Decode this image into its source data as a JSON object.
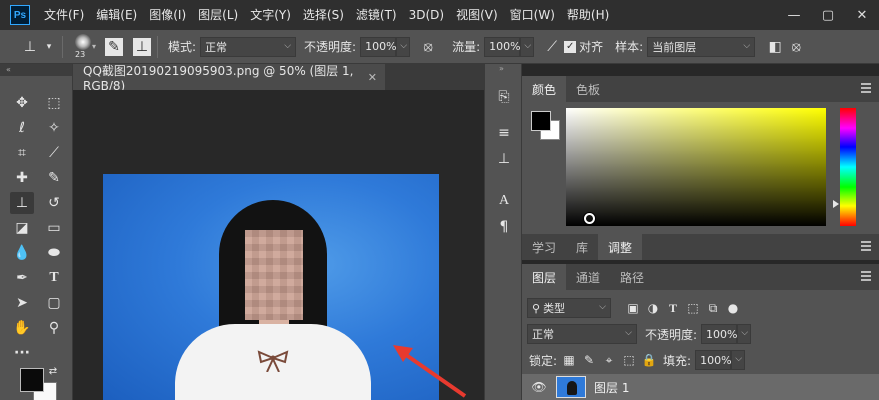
{
  "menu": {
    "logo": "Ps",
    "items": [
      "文件(F)",
      "编辑(E)",
      "图像(I)",
      "图层(L)",
      "文字(Y)",
      "选择(S)",
      "滤镜(T)",
      "3D(D)",
      "视图(V)",
      "窗口(W)",
      "帮助(H)"
    ],
    "window_buttons": [
      "—",
      "▢",
      "✕"
    ]
  },
  "options": {
    "brush_size": "23",
    "mode_label": "模式:",
    "mode_value": "正常",
    "opacity_label": "不透明度:",
    "opacity_value": "100%",
    "flow_label": "流量:",
    "flow_value": "100%",
    "align_label": "对齐",
    "sample_label": "样本:",
    "sample_value": "当前图层"
  },
  "document": {
    "tab_title": "QQ截图20190219095903.png @ 50% (图层 1, RGB/8)",
    "close": "✕"
  },
  "color_panel": {
    "tabs": [
      "颜色",
      "色板"
    ],
    "fg_color": "#000000",
    "bg_color": "#ffffff"
  },
  "mid_panel": {
    "tabs": [
      "学习",
      "库",
      "调整"
    ]
  },
  "layers_panel": {
    "tabs": [
      "图层",
      "通道",
      "路径"
    ],
    "filter_label": "类型",
    "blend_mode": "正常",
    "opacity_label": "不透明度:",
    "opacity_value": "100%",
    "lock_label": "锁定:",
    "fill_label": "填充:",
    "fill_value": "100%",
    "layers": [
      {
        "name": "图层 1"
      }
    ]
  }
}
